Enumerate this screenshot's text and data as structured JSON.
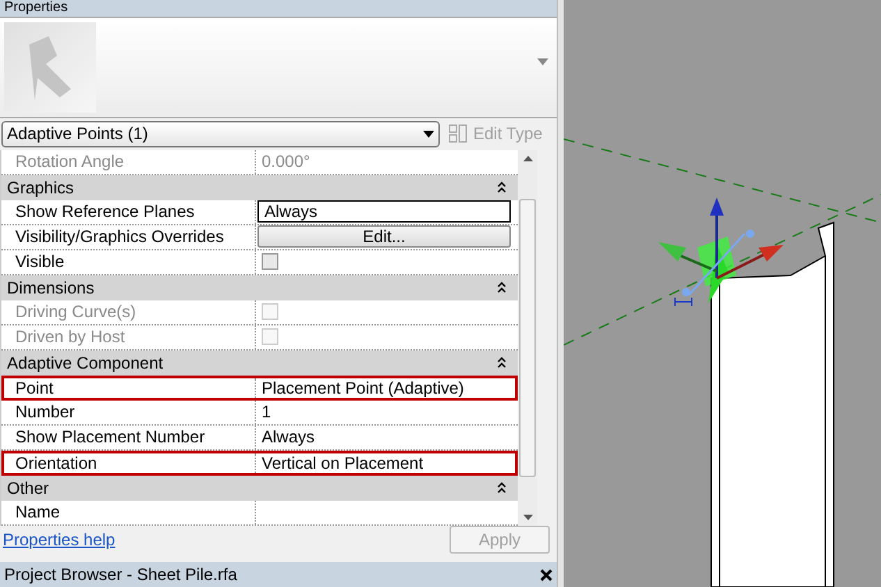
{
  "properties_panel": {
    "title": "Properties",
    "type_selector": "Adaptive Points (1)",
    "edit_type": "Edit Type",
    "rows_top": [
      {
        "kind": "text",
        "label": "Rotation Angle",
        "value": "0.000°",
        "disabled": true,
        "highlighted": false
      }
    ],
    "sections": [
      {
        "title": "Graphics",
        "rows": [
          {
            "kind": "field",
            "label": "Show Reference Planes",
            "value": "Always",
            "disabled": false,
            "highlighted": false
          },
          {
            "kind": "button",
            "label": "Visibility/Graphics Overrides",
            "value": "Edit...",
            "disabled": false,
            "highlighted": false
          },
          {
            "kind": "checkbox",
            "label": "Visible",
            "checked": false,
            "disabled": false,
            "highlighted": false
          }
        ]
      },
      {
        "title": "Dimensions",
        "rows": [
          {
            "kind": "checkbox",
            "label": "Driving Curve(s)",
            "checked": false,
            "disabled": true,
            "highlighted": false
          },
          {
            "kind": "checkbox",
            "label": "Driven by Host",
            "checked": false,
            "disabled": true,
            "highlighted": false
          }
        ]
      },
      {
        "title": "Adaptive Component",
        "rows": [
          {
            "kind": "text",
            "label": "Point",
            "value": "Placement Point (Adaptive)",
            "disabled": false,
            "highlighted": true
          },
          {
            "kind": "text",
            "label": "Number",
            "value": "1",
            "disabled": false,
            "highlighted": false
          },
          {
            "kind": "text",
            "label": "Show Placement Number",
            "value": "Always",
            "disabled": false,
            "highlighted": false
          },
          {
            "kind": "text",
            "label": "Orientation",
            "value": "Vertical on Placement",
            "disabled": false,
            "highlighted": true
          }
        ]
      },
      {
        "title": "Other",
        "rows": [
          {
            "kind": "text",
            "label": "Name",
            "value": "",
            "disabled": false,
            "highlighted": false
          }
        ]
      }
    ],
    "help_link": "Properties help",
    "apply": "Apply"
  },
  "project_browser": {
    "title": "Project Browser - Sheet Pile.rfa"
  }
}
